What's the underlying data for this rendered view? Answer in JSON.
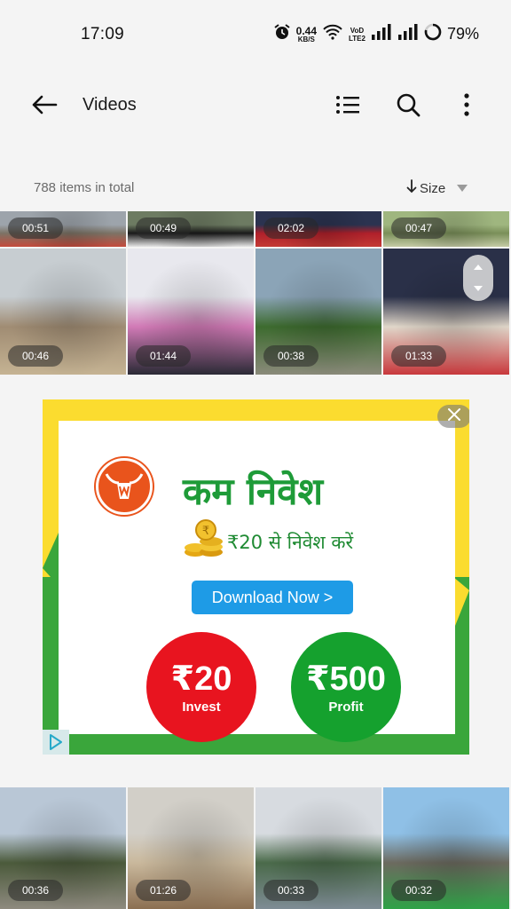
{
  "status_bar": {
    "time": "17:09",
    "net_speed_value": "0.44",
    "net_speed_unit": "KB/S",
    "volte_line1": "VoD",
    "volte_line2": "LTE2",
    "battery_text": "79%",
    "battery_level": 0.79,
    "icons": [
      "alarm-icon",
      "wifi-icon",
      "signal-icon",
      "signal-icon",
      "battery-ring-icon"
    ]
  },
  "app_bar": {
    "title": "Videos",
    "icons": [
      "back-arrow-icon",
      "list-view-icon",
      "search-icon",
      "more-vert-icon"
    ]
  },
  "sub_header": {
    "count_label": "788 items in total",
    "sort_label": "Size",
    "icons": [
      "sort-down-arrow-icon",
      "caret-down-icon"
    ]
  },
  "videos_top": [
    {
      "duration": "00:51",
      "colors": [
        "#9da4ab",
        "#7c7365",
        "#c44a3c"
      ]
    },
    {
      "duration": "00:49",
      "colors": [
        "#6d7b62",
        "#1a1a1a",
        "#e6e6e6"
      ]
    },
    {
      "duration": "02:02",
      "colors": [
        "#2b3350",
        "#b0202a",
        "#c33a35"
      ]
    },
    {
      "duration": "00:47",
      "colors": [
        "#9fb67f",
        "#7a8f59",
        "#c4cba5"
      ]
    },
    {
      "duration": "00:46",
      "colors": [
        "#c7cdd1",
        "#a08c73",
        "#c5b393"
      ]
    },
    {
      "duration": "01:44",
      "colors": [
        "#e8e8ee",
        "#d17ab6",
        "#2a2a35"
      ]
    },
    {
      "duration": "00:38",
      "colors": [
        "#8ba4b7",
        "#3d6b2f",
        "#8a8a7a"
      ]
    },
    {
      "duration": "01:33",
      "colors": [
        "#2a3048",
        "#e0d6c9",
        "#c8383c"
      ]
    }
  ],
  "videos_bottom": [
    {
      "duration": "00:36",
      "colors": [
        "#b9c7d6",
        "#4b5a3b",
        "#8e8a7f"
      ]
    },
    {
      "duration": "01:26",
      "colors": [
        "#d2cfc8",
        "#c9b89c",
        "#8b6f52"
      ]
    },
    {
      "duration": "00:33",
      "colors": [
        "#d7dbe0",
        "#4a6a4a",
        "#7e8c95"
      ]
    },
    {
      "duration": "00:32",
      "colors": [
        "#8fc0e6",
        "#6c6a5f",
        "#2fa247"
      ]
    }
  ],
  "ad": {
    "headline": "कम निवेश",
    "subline": "₹20 से निवेश करें",
    "button_label": "Download Now >",
    "left_amount": "₹20",
    "left_label": "Invest",
    "right_amount": "₹500",
    "right_label": "Profit",
    "colors": {
      "yellow": "#fbdc2f",
      "green": "#3aa63b",
      "red": "#e8141f",
      "profit_green": "#15a12e",
      "button": "#1e9be6",
      "logo": "#e9541c"
    },
    "icons": [
      "close-icon",
      "bull-logo-icon",
      "coin-stack-icon",
      "ad-choices-icon"
    ]
  },
  "scroll_handle": {
    "icons": [
      "chevron-up-icon",
      "chevron-down-icon"
    ]
  }
}
